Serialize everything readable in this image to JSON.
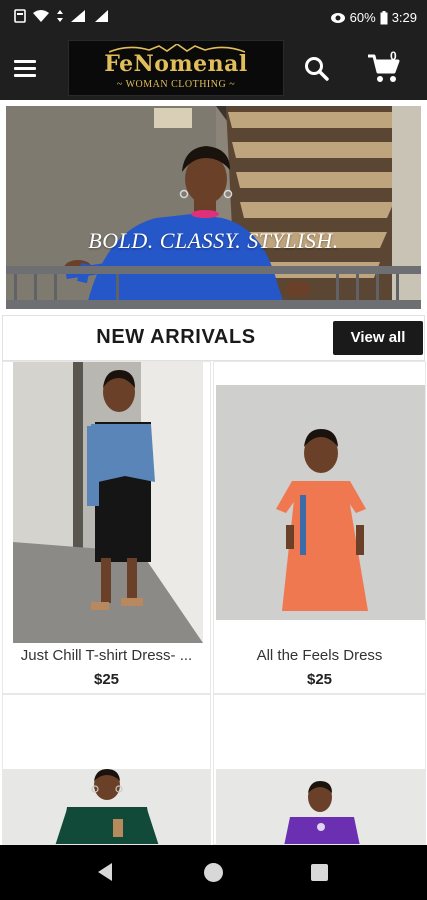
{
  "status_bar": {
    "battery": "60%",
    "time": "3:29"
  },
  "header": {
    "logo_main": "FeNomenal",
    "logo_sub": "~ WOMAN CLOTHING ~",
    "cart_count": "0"
  },
  "hero": {
    "tagline": "BOLD. CLASSY. STYLISH."
  },
  "section": {
    "title": "NEW ARRIVALS",
    "view_all_label": "View all"
  },
  "products": [
    {
      "name": "Just Chill T-shirt Dress- ...",
      "price": "$25",
      "dress_color": "#151515",
      "top_color": "#5a85b8"
    },
    {
      "name": "All the Feels Dress",
      "price": "$25",
      "dress_color": "#f07850",
      "top_color": "#f07850"
    },
    {
      "name": "",
      "price": "",
      "dress_color": "#124a3a",
      "top_color": "#124a3a"
    },
    {
      "name": "",
      "price": "",
      "dress_color": "#6b2fb2",
      "top_color": "#6b2fb2"
    }
  ],
  "colors": {
    "bar_dark": "#1f1f1f",
    "logo_gold": "#e2be5a",
    "hero_dress": "#2557c8"
  }
}
